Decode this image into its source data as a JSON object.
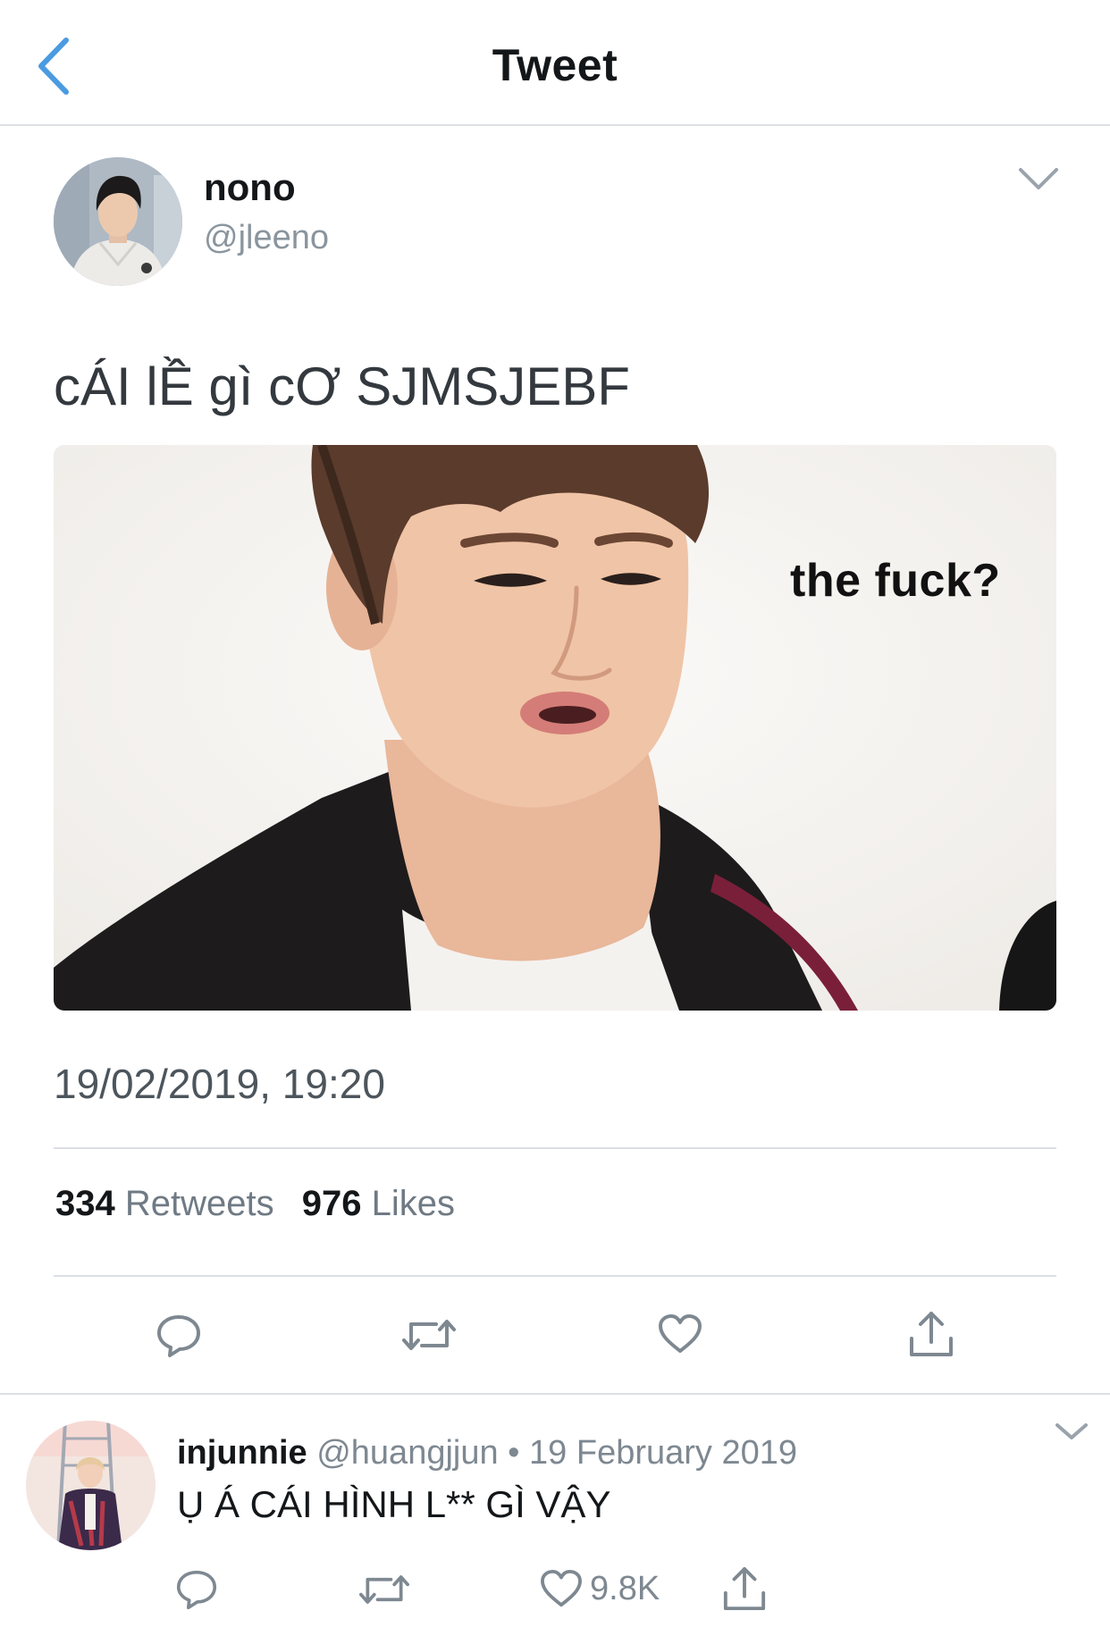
{
  "header": {
    "title": "Tweet",
    "back_icon": "chevron-left-icon"
  },
  "colors": {
    "accent": "#4a9be0",
    "text_primary": "#14171a",
    "text_secondary": "#7e8891",
    "divider": "#dcdfe3"
  },
  "tweet": {
    "author_name": "nono",
    "author_handle": "@jleeno",
    "text": "cÁI lỀ gì cƠ SJMSJEBF",
    "media": {
      "caption": "the fuck?"
    },
    "timestamp": "19/02/2019, 19:20",
    "stats": {
      "retweets_count": "334",
      "retweets_label": "Retweets",
      "likes_count": "976",
      "likes_label": "Likes"
    },
    "actions": [
      "reply-icon",
      "retweet-icon",
      "like-icon",
      "share-icon"
    ]
  },
  "reply": {
    "author_name": "injunnie",
    "meta": "@huangjjun • 19 February 2019",
    "text": "Ụ Á CÁI HÌNH L** GÌ VẬY",
    "like_count": "9.8K",
    "actions": [
      "reply-icon",
      "retweet-icon",
      "like-icon",
      "share-icon"
    ]
  }
}
